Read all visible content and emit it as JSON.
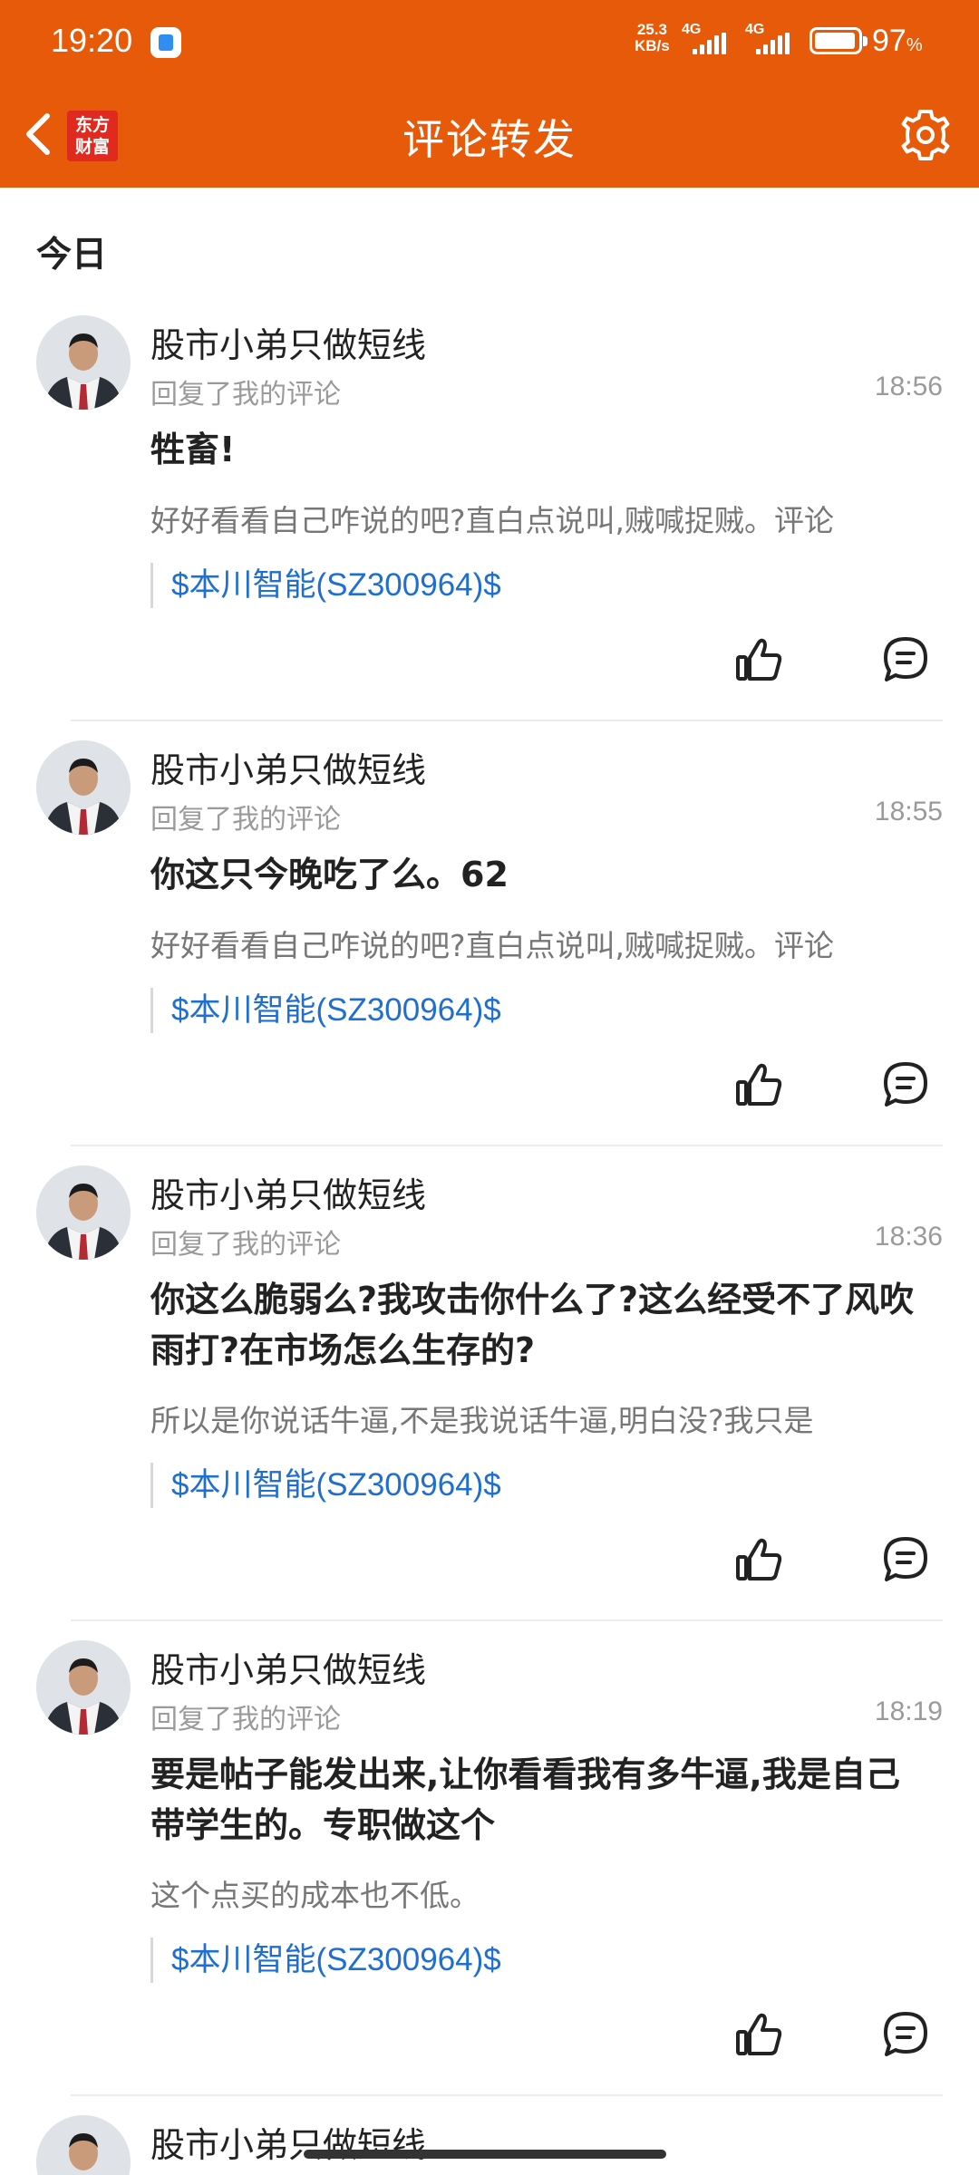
{
  "status_bar": {
    "time": "19:20",
    "net_speed_value": "25.3",
    "net_speed_unit": "KB/s",
    "sim1": "4G",
    "sim2": "4G",
    "battery_value": "97",
    "battery_unit": "%"
  },
  "header": {
    "logo_line1": "东方",
    "logo_line2": "财富",
    "title": "评论转发",
    "back_icon": "chevron-left-icon",
    "settings_icon": "gear-icon",
    "brand_color": "#E75A0A"
  },
  "section": {
    "label": "今日"
  },
  "items": [
    {
      "username": "股市小弟只做短线",
      "subtitle": "回复了我的评论",
      "time": "18:56",
      "content": "牲畜!",
      "quote": "好好看看自己咋说的吧?直白点说叫,贼喊捉贼。评论",
      "stock": "$本川智能(SZ300964)$"
    },
    {
      "username": "股市小弟只做短线",
      "subtitle": "回复了我的评论",
      "time": "18:55",
      "content": "你这只今晚吃了么。62",
      "quote": "好好看看自己咋说的吧?直白点说叫,贼喊捉贼。评论",
      "stock": "$本川智能(SZ300964)$"
    },
    {
      "username": "股市小弟只做短线",
      "subtitle": "回复了我的评论",
      "time": "18:36",
      "content": "你这么脆弱么?我攻击你什么了?这么经受不了风吹雨打?在市场怎么生存的?",
      "quote": "所以是你说话牛逼,不是我说话牛逼,明白没?我只是",
      "stock": "$本川智能(SZ300964)$"
    },
    {
      "username": "股市小弟只做短线",
      "subtitle": "回复了我的评论",
      "time": "18:19",
      "content": "要是帖子能发出来,让你看看我有多牛逼,我是自己带学生的。专职做这个",
      "quote": "这个点买的成本也不低。",
      "stock": "$本川智能(SZ300964)$"
    },
    {
      "username": "股市小弟只做短线"
    }
  ],
  "icons": {
    "like": "thumbs-up-icon",
    "comment": "comment-bubble-icon",
    "link_color": "#1F6FD1"
  }
}
